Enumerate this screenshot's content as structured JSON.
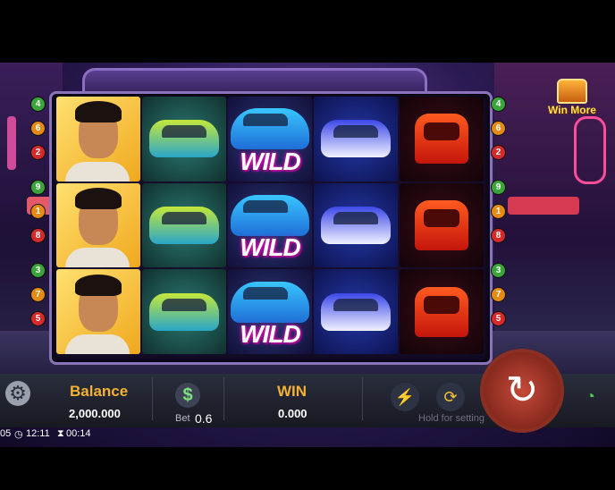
{
  "paylines": {
    "left": [
      {
        "n": "4",
        "c": "green"
      },
      {
        "n": "6",
        "c": "orange"
      },
      {
        "n": "2",
        "c": "red"
      },
      {
        "n": "9",
        "c": "green"
      },
      {
        "n": "1",
        "c": "orange"
      },
      {
        "n": "8",
        "c": "red"
      },
      {
        "n": "3",
        "c": "green"
      },
      {
        "n": "7",
        "c": "orange"
      },
      {
        "n": "5",
        "c": "red"
      }
    ],
    "right": [
      {
        "n": "4",
        "c": "green"
      },
      {
        "n": "6",
        "c": "orange"
      },
      {
        "n": "2",
        "c": "red"
      },
      {
        "n": "9",
        "c": "green"
      },
      {
        "n": "1",
        "c": "orange"
      },
      {
        "n": "8",
        "c": "red"
      },
      {
        "n": "3",
        "c": "green"
      },
      {
        "n": "7",
        "c": "orange"
      },
      {
        "n": "5",
        "c": "red"
      }
    ]
  },
  "reels": [
    [
      "man",
      "man",
      "man"
    ],
    [
      "taxi",
      "taxi",
      "taxi"
    ],
    [
      "wild",
      "wild",
      "wild"
    ],
    [
      "police",
      "police",
      "police"
    ],
    [
      "tuk",
      "tuk",
      "tuk"
    ]
  ],
  "symbols": {
    "wild_text": "WILD"
  },
  "win_more": {
    "label": "Win More"
  },
  "footer": {
    "balance_label": "Balance",
    "balance_value": "2,000.000",
    "bet_label": "Bet",
    "bet_value": "0.6",
    "win_label": "WIN",
    "win_value": "0.000",
    "hold_hint": "Hold for setting"
  },
  "status": {
    "left_fragment": "05",
    "clock": "12:11",
    "timer": "00:14"
  },
  "colors": {
    "accent_gold": "#f3b233",
    "spin_red": "#c44a38",
    "wifi_green": "#4cd14c"
  },
  "icons": [
    "gear-icon",
    "dollar-icon",
    "lightning-icon",
    "auto-spin-icon",
    "spin-arrow-icon",
    "wifi-icon",
    "clock-icon",
    "hourglass-icon",
    "chest-icon"
  ]
}
